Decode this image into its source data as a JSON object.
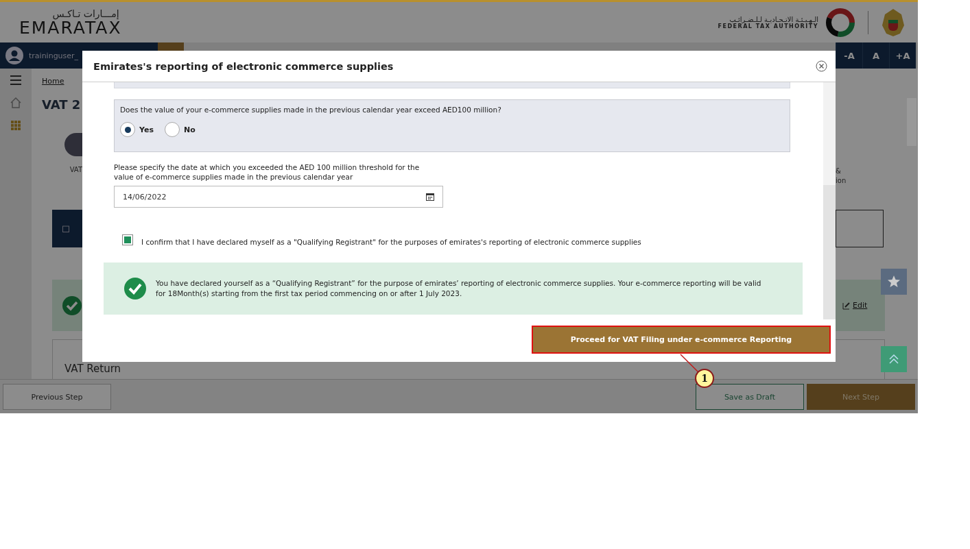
{
  "header": {
    "logo_arabic": "إمـــارات تـاكـس",
    "logo": "EMARATAX",
    "authority_arabic": "الـهـيـئـة الاتـحـاديـة لـلـضـرائـب",
    "authority": "FEDERAL TAX AUTHORITY"
  },
  "nav": {
    "user": "traininguser_",
    "font_sizes": [
      "-A",
      "A",
      "+A"
    ]
  },
  "breadcrumb": "Home",
  "page_title": "VAT 2",
  "step_left": "VAT",
  "step_right": [
    "&",
    "ion"
  ],
  "edit_link": "Edit",
  "section_title": "VAT Return",
  "footer": {
    "previous": "Previous Step",
    "save": "Save as Draft",
    "next": "Next Step"
  },
  "modal": {
    "title": "Emirates's reporting of electronic commerce supplies",
    "question": "Does the value of your e-commerce supplies made in the previous calendar year exceed AED100 million?",
    "options": [
      {
        "label": "Yes",
        "selected": true
      },
      {
        "label": "No",
        "selected": false
      }
    ],
    "date_label": "Please specify the date at which you exceeded the AED 100 million threshold for the value of e-commerce supplies made in the previous calendar year",
    "date": "14/06/2022",
    "confirm": {
      "checked": true,
      "text": "I confirm that I have declared myself as a \"Qualifying Registrant\" for the purposes of emirates's reporting of electronic commerce supplies"
    },
    "notice": "You have declared yourself as a “Qualifying Registrant” for the purpose of emirates’ reporting of electronic commerce supplies. Your e-commerce reporting will be valid for 18Month(s) starting from the first tax period commencing on or after 1 July 2023.",
    "proceed": "Proceed for VAT Filing under e-commerce Reporting"
  },
  "callout": "1"
}
